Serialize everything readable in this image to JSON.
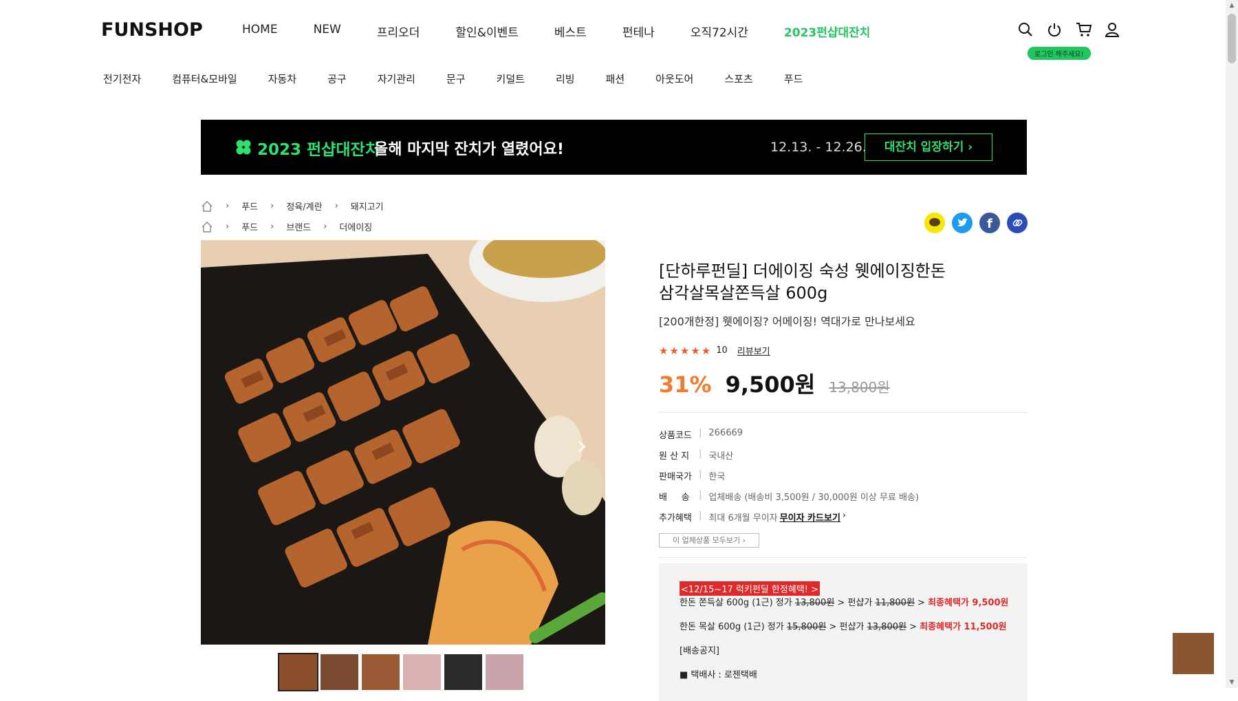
{
  "header": {
    "logo": "FUNSHOP",
    "main_nav": [
      "HOME",
      "NEW",
      "프리오더",
      "할인&이벤트",
      "베스트",
      "펀테나",
      "오직72시간",
      "2023펀샵대잔치"
    ],
    "login_tip": "로그인 해주세요!",
    "icons": [
      "search-icon",
      "power-icon",
      "cart-icon",
      "user-icon"
    ]
  },
  "category_nav": [
    "전기전자",
    "컴퓨터&모바일",
    "자동차",
    "공구",
    "자기관리",
    "문구",
    "키덜트",
    "리빙",
    "패션",
    "아웃도어",
    "스포츠",
    "푸드"
  ],
  "banner": {
    "title": "2023 펀샵대잔치",
    "subtitle": "올해 마지막 잔치가 열렸어요!",
    "date": "12.13. - 12.26.",
    "button": "대잔치 입장하기 ›"
  },
  "breadcrumbs": [
    [
      "푸드",
      "정육/계란",
      "돼지고기"
    ],
    [
      "푸드",
      "브랜드",
      "더에이징"
    ]
  ],
  "product": {
    "title_line1": "[단하루펀딜] 더에이징 숙성 웻에이징한돈",
    "title_line2": "삼각살목살쫀득살 600g",
    "subtitle": "[200개한정] 웻에이징? 어메이징! 역대가로 만나보세요",
    "stars": "★★★★★",
    "review_count": "10",
    "review_link": "리뷰보기",
    "discount": "31%",
    "price": "9,500원",
    "original_price": "13,800원"
  },
  "specs": [
    {
      "key": "상품코드",
      "value": "266669"
    },
    {
      "key": "원 산 지",
      "value": "국내산"
    },
    {
      "key": "판매국가",
      "value": "한국"
    },
    {
      "key": "배     송",
      "value": "업체배송 (배송비 3,500원 / 30,000원 이상 무료 배송)"
    },
    {
      "key": "추가혜택",
      "value": "최대 6개월 무이자",
      "link": "무이자 카드보기"
    }
  ],
  "vendor_button": "이 업체상품 모두보기",
  "notice": {
    "head": "<12/15~17 럭키펀딜 한정혜택! >",
    "line1_a": "한돈 쫀득살 600g (1근) 정가 ",
    "line1_b": "13,800원",
    "line1_c": " > 펀샵가 ",
    "line1_d": "11,800원",
    "line1_e": " > ",
    "line1_f": "최종혜택가 9,500원",
    "line2_a": "한돈 목살 600g (1근) 정가 ",
    "line2_b": "15,800원",
    "line2_c": " > 펀샵가 ",
    "line2_d": "13,800원",
    "line2_e": " > ",
    "line2_f": "최종혜택가 11,500원",
    "line3": "[배송공지]",
    "line4": "■ 택배사 : 로젠택배"
  },
  "colors": {
    "brand_green": "#22c55e",
    "discount_orange": "#f47b2c",
    "notice_red": "#e02a2a"
  }
}
